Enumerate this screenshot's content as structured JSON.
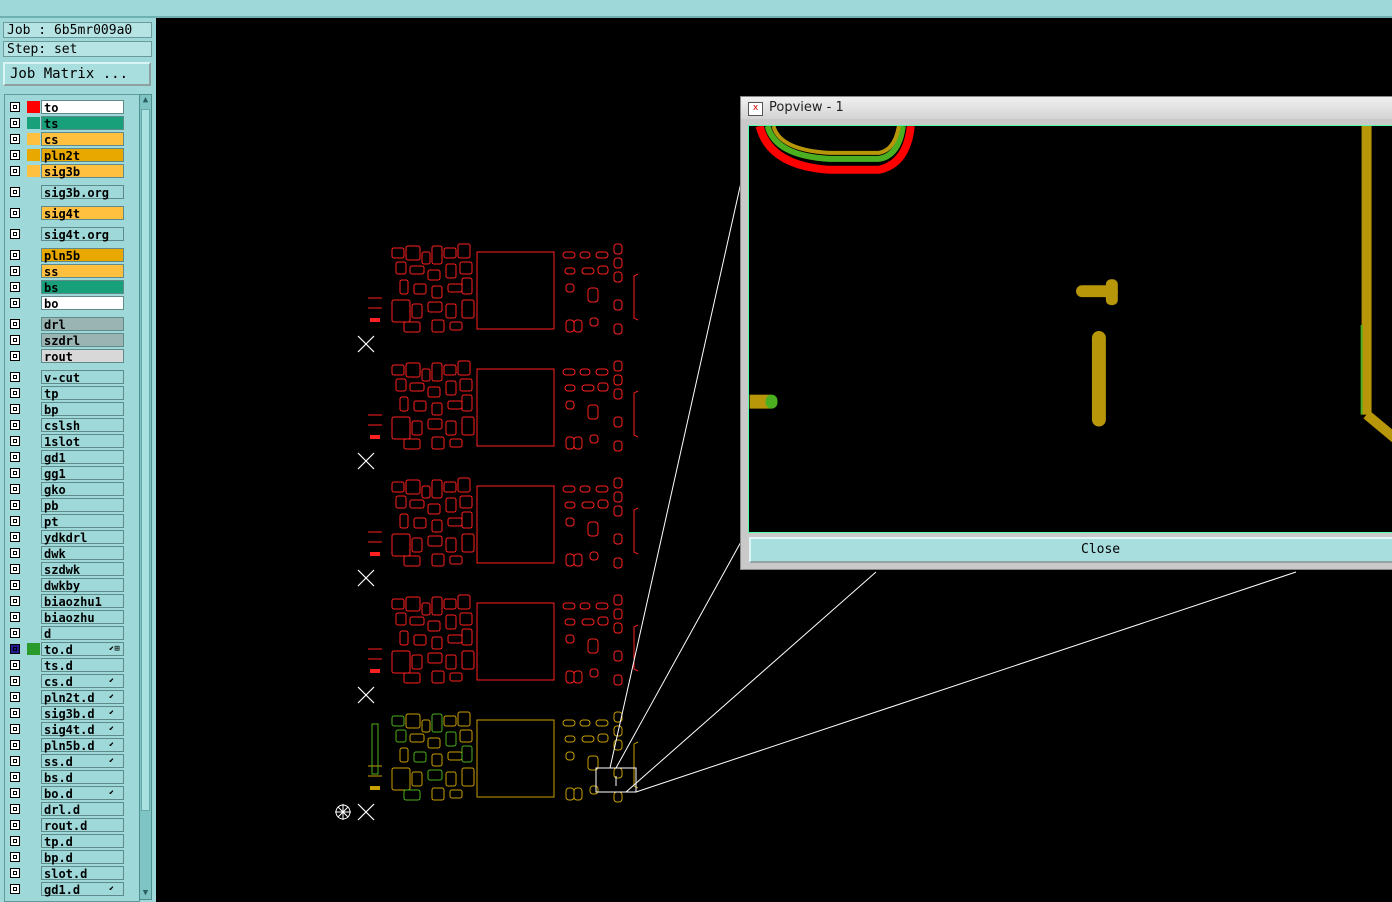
{
  "job": {
    "label": "Job : 6b5mr009a0"
  },
  "step": {
    "label": "Step: set"
  },
  "job_matrix_label": "Job Matrix ...",
  "layers": [
    {
      "name": "to",
      "color": "#ffffff",
      "swatch": "#ff0000"
    },
    {
      "name": "ts",
      "color": "#17a07a",
      "swatch": "#17a07a"
    },
    {
      "name": "cs",
      "color": "#ffc040",
      "swatch": "#ffc040"
    },
    {
      "name": "pln2t",
      "color": "#e8a800",
      "swatch": "#e8a800"
    },
    {
      "name": "sig3b",
      "color": "#ffc040",
      "swatch": "#ffc040"
    },
    {
      "name": "sig3b.org",
      "color": "#9ed8d8",
      "swatch": ""
    },
    {
      "name": "sig4t",
      "color": "#ffc040",
      "swatch": ""
    },
    {
      "name": "sig4t.org",
      "color": "#9ed8d8",
      "swatch": ""
    },
    {
      "name": "pln5b",
      "color": "#e8a800",
      "swatch": ""
    },
    {
      "name": "ss",
      "color": "#ffc040",
      "swatch": ""
    },
    {
      "name": "bs",
      "color": "#17a07a",
      "swatch": ""
    },
    {
      "name": "bo",
      "color": "#ffffff",
      "swatch": ""
    },
    {
      "name": "drl",
      "color": "#9ab4b4",
      "swatch": ""
    },
    {
      "name": "szdrl",
      "color": "#9ab4b4",
      "swatch": ""
    },
    {
      "name": "rout",
      "color": "#d8d8d8",
      "swatch": ""
    },
    {
      "name": "v-cut",
      "color": "#9ed8d8",
      "swatch": ""
    },
    {
      "name": "tp",
      "color": "#9ed8d8",
      "swatch": ""
    },
    {
      "name": "bp",
      "color": "#9ed8d8",
      "swatch": ""
    },
    {
      "name": "cslsh",
      "color": "#9ed8d8",
      "swatch": ""
    },
    {
      "name": "1slot",
      "color": "#9ed8d8",
      "swatch": ""
    },
    {
      "name": "gd1",
      "color": "#9ed8d8",
      "swatch": ""
    },
    {
      "name": "gg1",
      "color": "#9ed8d8",
      "swatch": ""
    },
    {
      "name": "gko",
      "color": "#9ed8d8",
      "swatch": ""
    },
    {
      "name": "pb",
      "color": "#9ed8d8",
      "swatch": ""
    },
    {
      "name": "pt",
      "color": "#9ed8d8",
      "swatch": ""
    },
    {
      "name": "ydkdrl",
      "color": "#9ed8d8",
      "swatch": ""
    },
    {
      "name": "dwk",
      "color": "#9ed8d8",
      "swatch": ""
    },
    {
      "name": "szdwk",
      "color": "#9ed8d8",
      "swatch": ""
    },
    {
      "name": "dwkby",
      "color": "#9ed8d8",
      "swatch": ""
    },
    {
      "name": "biaozhu1",
      "color": "#9ed8d8",
      "swatch": ""
    },
    {
      "name": "biaozhu",
      "color": "#9ed8d8",
      "swatch": ""
    },
    {
      "name": "d",
      "color": "#9ed8d8",
      "swatch": ""
    },
    {
      "name": "to.d",
      "color": "#9ed8d8",
      "swatch": "#2a9a2a",
      "active": true,
      "flag": "⬋⊞"
    },
    {
      "name": "ts.d",
      "color": "#9ed8d8",
      "swatch": ""
    },
    {
      "name": "cs.d",
      "color": "#9ed8d8",
      "swatch": "",
      "flag": "⬋"
    },
    {
      "name": "pln2t.d",
      "color": "#9ed8d8",
      "swatch": "",
      "flag": "⬋"
    },
    {
      "name": "sig3b.d",
      "color": "#9ed8d8",
      "swatch": "",
      "flag": "⬋"
    },
    {
      "name": "sig4t.d",
      "color": "#9ed8d8",
      "swatch": "",
      "flag": "⬋"
    },
    {
      "name": "pln5b.d",
      "color": "#9ed8d8",
      "swatch": "",
      "flag": "⬋"
    },
    {
      "name": "ss.d",
      "color": "#9ed8d8",
      "swatch": "",
      "flag": "⬋"
    },
    {
      "name": "bs.d",
      "color": "#9ed8d8",
      "swatch": ""
    },
    {
      "name": "bo.d",
      "color": "#9ed8d8",
      "swatch": "",
      "flag": "⬋"
    },
    {
      "name": "drl.d",
      "color": "#9ed8d8",
      "swatch": ""
    },
    {
      "name": "rout.d",
      "color": "#9ed8d8",
      "swatch": ""
    },
    {
      "name": "tp.d",
      "color": "#9ed8d8",
      "swatch": ""
    },
    {
      "name": "bp.d",
      "color": "#9ed8d8",
      "swatch": ""
    },
    {
      "name": "slot.d",
      "color": "#9ed8d8",
      "swatch": ""
    },
    {
      "name": "gd1.d",
      "color": "#9ed8d8",
      "swatch": "",
      "flag": "⬋"
    }
  ],
  "popup": {
    "title": "Popview - 1",
    "close_label": "Close"
  },
  "colors": {
    "board_outline": "#ff2020",
    "highlight_board": "#c8a000",
    "green": "#4caf20",
    "trace_gold": "#b8960a"
  }
}
